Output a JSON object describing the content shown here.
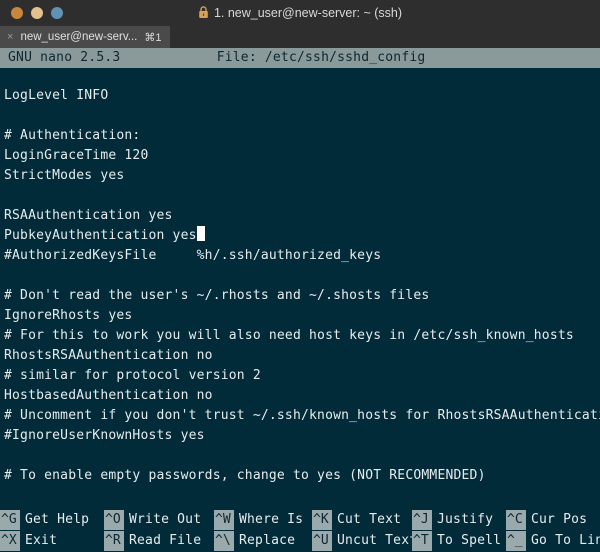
{
  "window": {
    "title": "1. new_user@new-server: ~ (ssh)",
    "lock_icon": "lock-icon",
    "traffic_lights": [
      {
        "name": "close",
        "color": "#c8873c"
      },
      {
        "name": "minimize",
        "color": "#e3c08d"
      },
      {
        "name": "maximize",
        "color": "#5f92b5"
      }
    ]
  },
  "tab": {
    "close_glyph": "×",
    "label": "new_user@new-serv...",
    "shortcut": "⌘1"
  },
  "nano": {
    "header": " GNU nano 2.5.3            File: /etc/ssh/sshd_config",
    "version": "GNU nano 2.5.3",
    "file_label": "File:",
    "file_path": "/etc/ssh/sshd_config",
    "header_bg": "#8a9a9a",
    "background": "#022b3a",
    "foreground": "#e6ecee"
  },
  "editor": {
    "cursor_line_index": 7,
    "cursor_column": 23,
    "lines": [
      "LogLevel INFO",
      "",
      "# Authentication:",
      "LoginGraceTime 120",
      "StrictModes yes",
      "",
      "RSAAuthentication yes",
      "PubkeyAuthentication yes",
      "#AuthorizedKeysFile     %h/.ssh/authorized_keys",
      "",
      "# Don't read the user's ~/.rhosts and ~/.shosts files",
      "IgnoreRhosts yes",
      "# For this to work you will also need host keys in /etc/ssh_known_hosts",
      "RhostsRSAAuthentication no",
      "# similar for protocol version 2",
      "HostbasedAuthentication no",
      "# Uncomment if you don't trust ~/.ssh/known_hosts for RhostsRSAAuthentication",
      "#IgnoreUserKnownHosts yes",
      "",
      "# To enable empty passwords, change to yes (NOT RECOMMENDED)"
    ]
  },
  "shortcuts": {
    "key_bg": "#9aa9ab",
    "columns": [
      {
        "top": {
          "key": "^G",
          "label": "Get Help"
        },
        "bottom": {
          "key": "^X",
          "label": "Exit"
        }
      },
      {
        "top": {
          "key": "^O",
          "label": "Write Out"
        },
        "bottom": {
          "key": "^R",
          "label": "Read File"
        }
      },
      {
        "top": {
          "key": "^W",
          "label": "Where Is"
        },
        "bottom": {
          "key": "^\\",
          "label": "Replace"
        }
      },
      {
        "top": {
          "key": "^K",
          "label": "Cut Text"
        },
        "bottom": {
          "key": "^U",
          "label": "Uncut Text"
        }
      },
      {
        "top": {
          "key": "^J",
          "label": "Justify"
        },
        "bottom": {
          "key": "^T",
          "label": "To Spell"
        }
      },
      {
        "top": {
          "key": "^C",
          "label": "Cur Pos"
        },
        "bottom": {
          "key": "^_",
          "label": "Go To Line"
        }
      }
    ]
  }
}
